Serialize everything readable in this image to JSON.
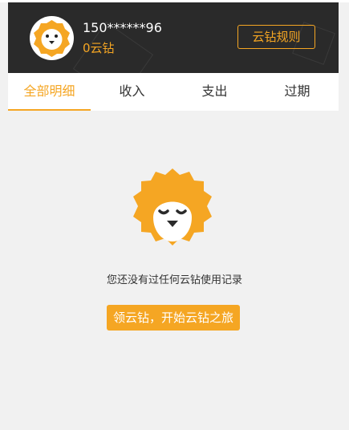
{
  "header": {
    "phone": "150******96",
    "coins": "0云钻",
    "rules_button": "云钻规则",
    "avatar_icon": "lion-mascot-icon"
  },
  "tabs": [
    {
      "label": "全部明细",
      "active": true
    },
    {
      "label": "收入",
      "active": false
    },
    {
      "label": "支出",
      "active": false
    },
    {
      "label": "过期",
      "active": false
    }
  ],
  "empty_state": {
    "icon": "sleeping-lion-icon",
    "message": "您还没有过任何云钻使用记录",
    "cta_label": "领云钻，开始云钻之旅"
  },
  "colors": {
    "accent": "#f5a623",
    "header_bg": "#2a2a2a",
    "page_bg": "#f1f1f1"
  }
}
